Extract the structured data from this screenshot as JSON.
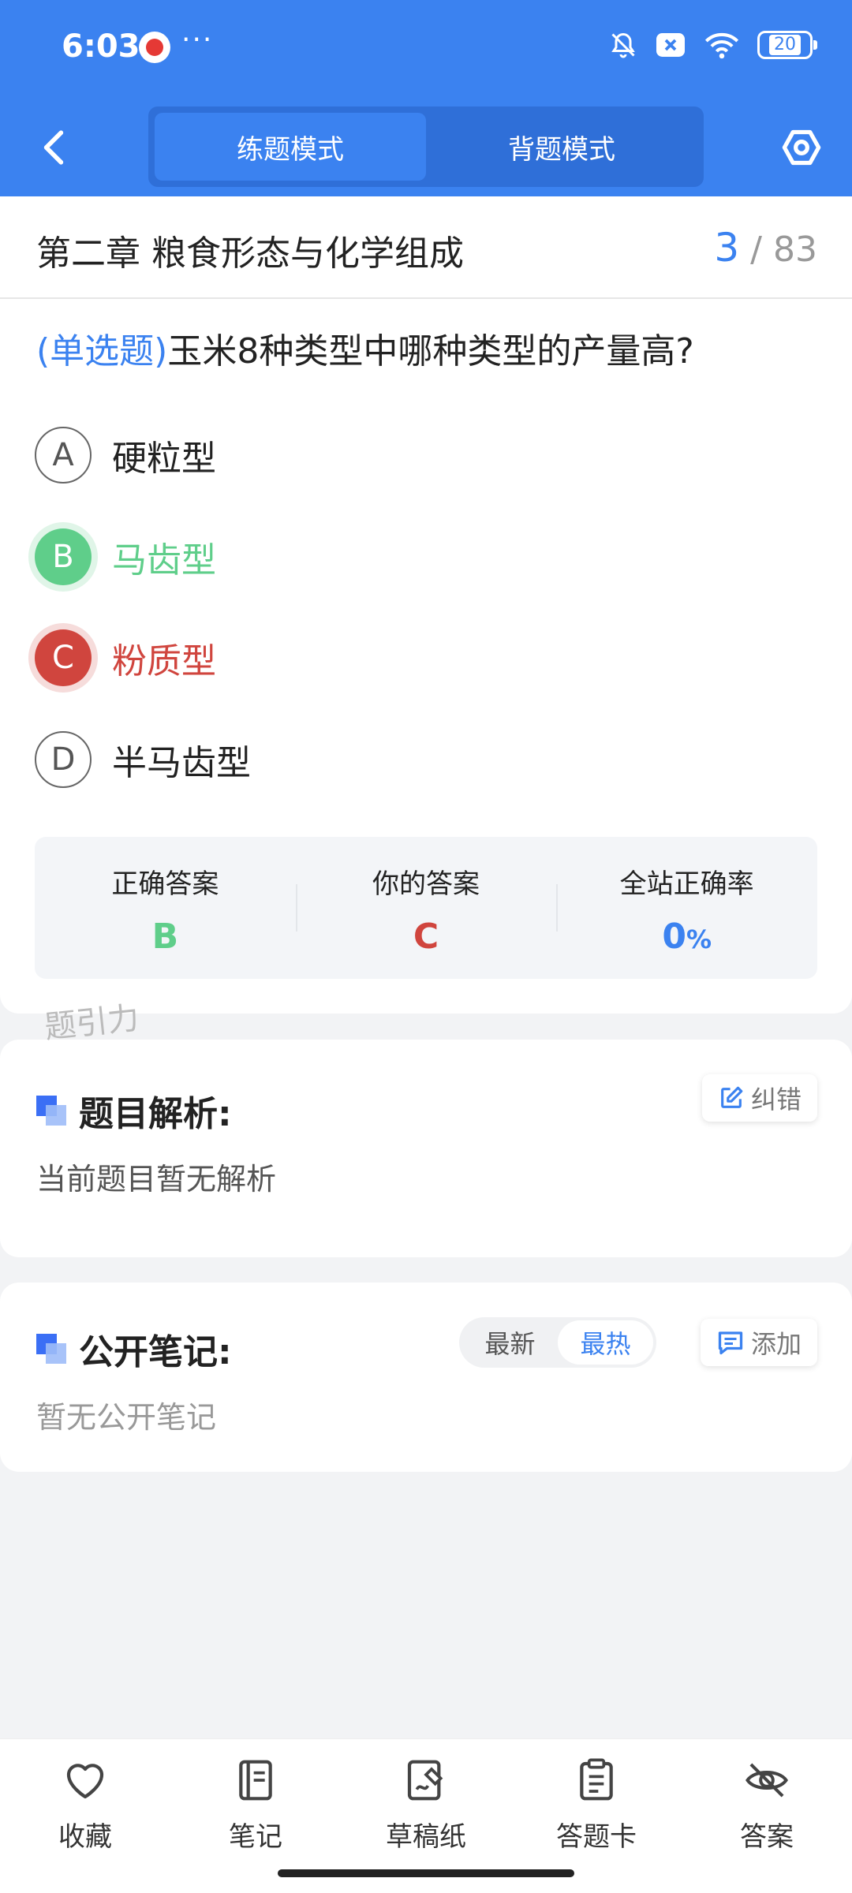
{
  "status_bar": {
    "time": "6:03",
    "more": "···",
    "battery": "20"
  },
  "header": {
    "tabs": [
      {
        "label": "练题模式",
        "active": true
      },
      {
        "label": "背题模式",
        "active": false
      }
    ]
  },
  "chapter": {
    "title": "第二章 粮食形态与化学组成",
    "current": "3",
    "sep": "/",
    "total": "83"
  },
  "question": {
    "type": "(单选题)",
    "text": "玉米8种类型中哪种类型的产量高?",
    "options": [
      {
        "letter": "A",
        "text": "硬粒型",
        "state": "normal"
      },
      {
        "letter": "B",
        "text": "马齿型",
        "state": "correct"
      },
      {
        "letter": "C",
        "text": "粉质型",
        "state": "wrong"
      },
      {
        "letter": "D",
        "text": "半马齿型",
        "state": "normal"
      }
    ]
  },
  "result": {
    "correct_label": "正确答案",
    "correct_value": "B",
    "yours_label": "你的答案",
    "yours_value": "C",
    "rate_label": "全站正确率",
    "rate_value": "0",
    "rate_unit": "%"
  },
  "watermark": "题引力",
  "analysis": {
    "title": "题目解析:",
    "report_label": "纠错",
    "body": "当前题目暂无解析"
  },
  "notes": {
    "title": "公开笔记:",
    "sort_latest": "最新",
    "sort_hot": "最热",
    "add_label": "添加",
    "body": "暂无公开笔记"
  },
  "bottom_nav": [
    {
      "label": "收藏",
      "icon": "heart-icon"
    },
    {
      "label": "笔记",
      "icon": "notebook-icon"
    },
    {
      "label": "草稿纸",
      "icon": "draft-icon"
    },
    {
      "label": "答题卡",
      "icon": "answer-sheet-icon"
    },
    {
      "label": "答案",
      "icon": "eye-off-icon"
    }
  ],
  "colors": {
    "primary": "#3b82f0",
    "correct": "#5fce8a",
    "wrong": "#d0453e"
  }
}
